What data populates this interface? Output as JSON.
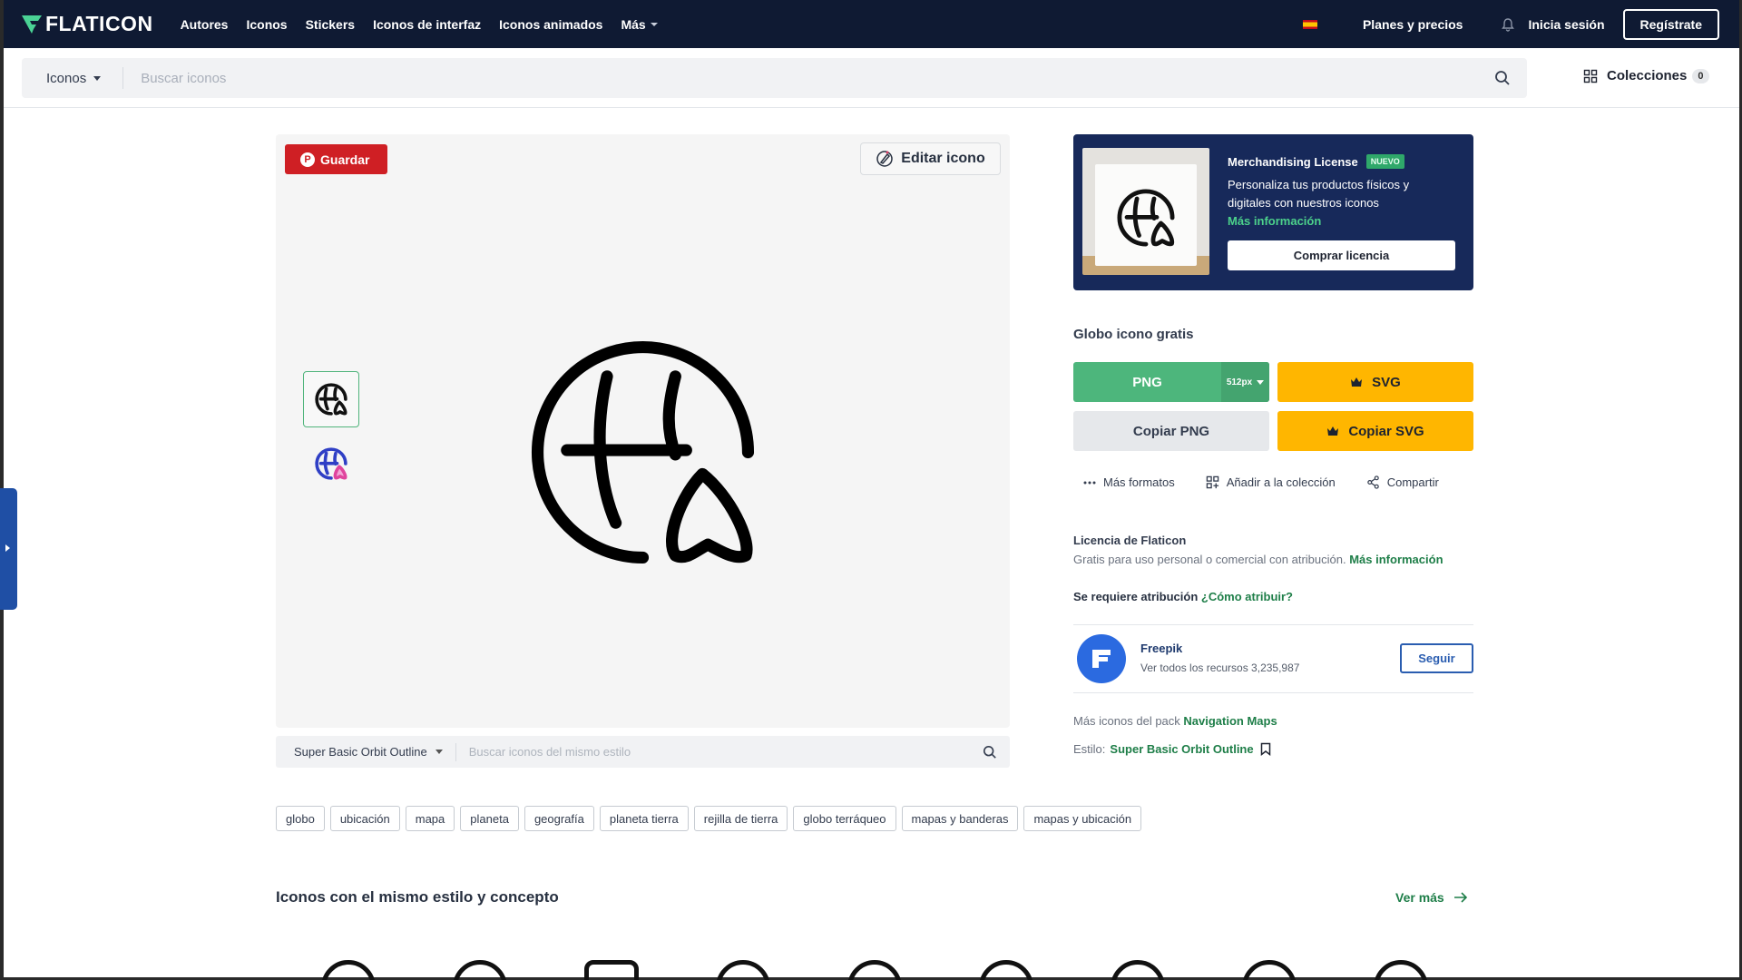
{
  "brand": {
    "name": "FLATICON"
  },
  "nav": {
    "links": [
      "Autores",
      "Iconos",
      "Stickers",
      "Iconos de interfaz",
      "Iconos animados",
      "Más"
    ],
    "plans": "Planes y precios",
    "login": "Inicia sesión",
    "register": "Regístrate"
  },
  "search": {
    "type": "Iconos",
    "placeholder": "Buscar iconos",
    "collections": "Colecciones",
    "collections_count": "0"
  },
  "preview": {
    "save": "Guardar",
    "edit": "Editar icono",
    "style_select": "Super Basic Orbit Outline",
    "style_placeholder": "Buscar iconos del mismo estilo"
  },
  "tags": [
    "globo",
    "ubicación",
    "mapa",
    "planeta",
    "geografía",
    "planeta tierra",
    "rejilla de tierra",
    "globo terráqueo",
    "mapas y banderas",
    "mapas y ubicación"
  ],
  "related": {
    "title": "Iconos con el mismo estilo y concepto",
    "see_more": "Ver más"
  },
  "merch": {
    "title": "Merchandising License",
    "badge": "NUEVO",
    "text": "Personaliza tus productos físicos y digitales con nuestros iconos",
    "more": "Más información",
    "buy": "Comprar licencia"
  },
  "download": {
    "title": "Globo icono gratis",
    "png": "PNG",
    "png_size": "512px",
    "svg": "SVG",
    "copy_png": "Copiar PNG",
    "copy_svg": "Copiar SVG",
    "more_formats": "Más formatos",
    "add_collection": "Añadir a la colección",
    "share": "Compartir"
  },
  "license": {
    "title": "Licencia de Flaticon",
    "text": "Gratis para uso personal o comercial con atribución.",
    "more": "Más información",
    "attr_required": "Se requiere atribución",
    "how": "¿Cómo atribuir?"
  },
  "author": {
    "name": "Freepik",
    "resources": "Ver todos los recursos 3,235,987",
    "follow": "Seguir"
  },
  "pack": {
    "label": "Más iconos del pack",
    "name": "Navigation Maps"
  },
  "style": {
    "label": "Estilo:",
    "name": "Super Basic Orbit Outline"
  },
  "colors": {
    "nav_bg": "#0f1a33",
    "green": "#4db67c",
    "yellow": "#ffb600",
    "link_green": "#1e7e48",
    "merch_bg": "#17295a"
  }
}
